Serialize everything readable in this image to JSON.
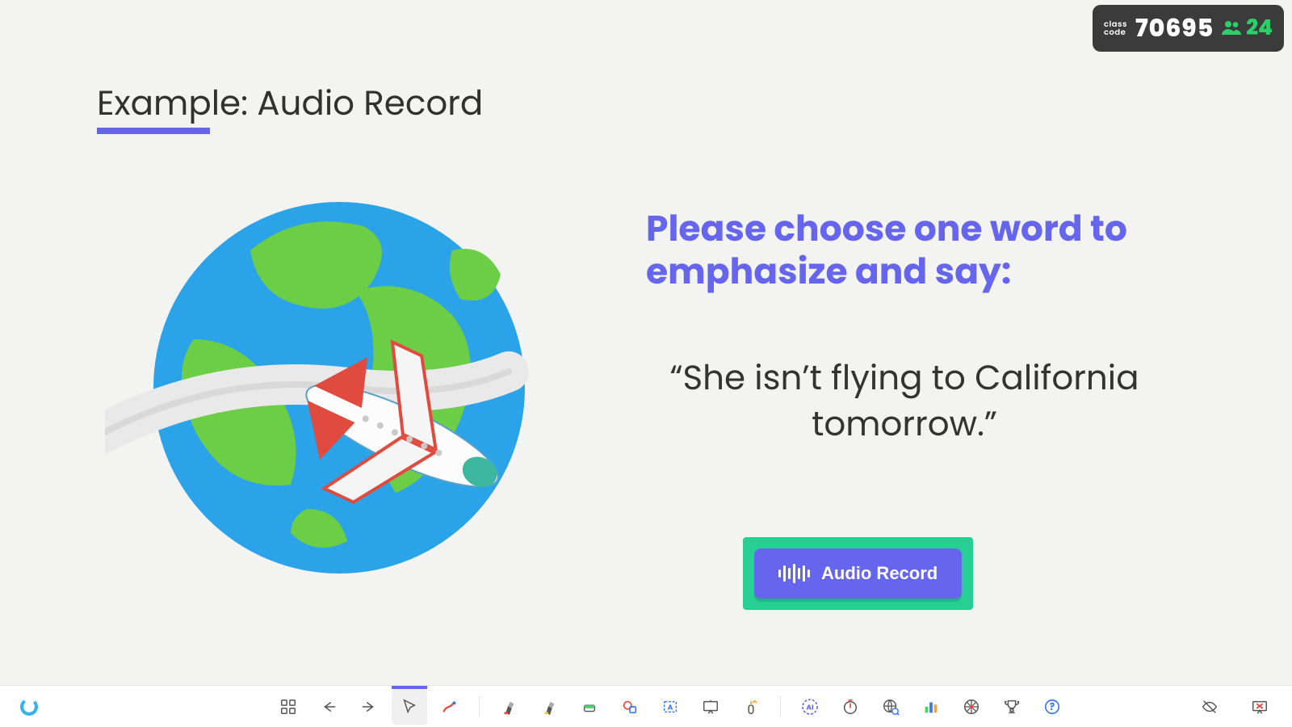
{
  "header": {
    "class_label_line1": "class",
    "class_label_line2": "code",
    "class_code": "70695",
    "participants": "24"
  },
  "slide": {
    "title": "Example: Audio Record",
    "instruction": "Please choose one word to emphasize and say:",
    "sentence": "“She isn’t flying to California tomorrow.”",
    "record_button_label": "Audio Record"
  },
  "toolbar": {
    "app_logo": "ClassPoint",
    "icons": {
      "grid": "slide-grid",
      "prev": "previous-slide",
      "next": "next-slide",
      "pointer": "pointer-tool",
      "pen": "pen-tool",
      "highlighter1": "highlighter-red",
      "highlighter2": "highlighter-yellow",
      "eraser": "eraser",
      "lasso": "lasso-select",
      "textbox": "text-box",
      "whiteboard": "whiteboard",
      "drag": "draggable-objects",
      "ai": "ai-quiz",
      "timer": "timer",
      "browser": "embedded-browser",
      "poll": "quick-poll",
      "wheel": "name-picker",
      "trophy": "award-stars",
      "help": "help",
      "hide": "hide-toolbar",
      "end": "end-slideshow"
    }
  },
  "colors": {
    "accent": "#6665ee",
    "green": "#27cf94",
    "badge_green": "#2cd06a"
  }
}
